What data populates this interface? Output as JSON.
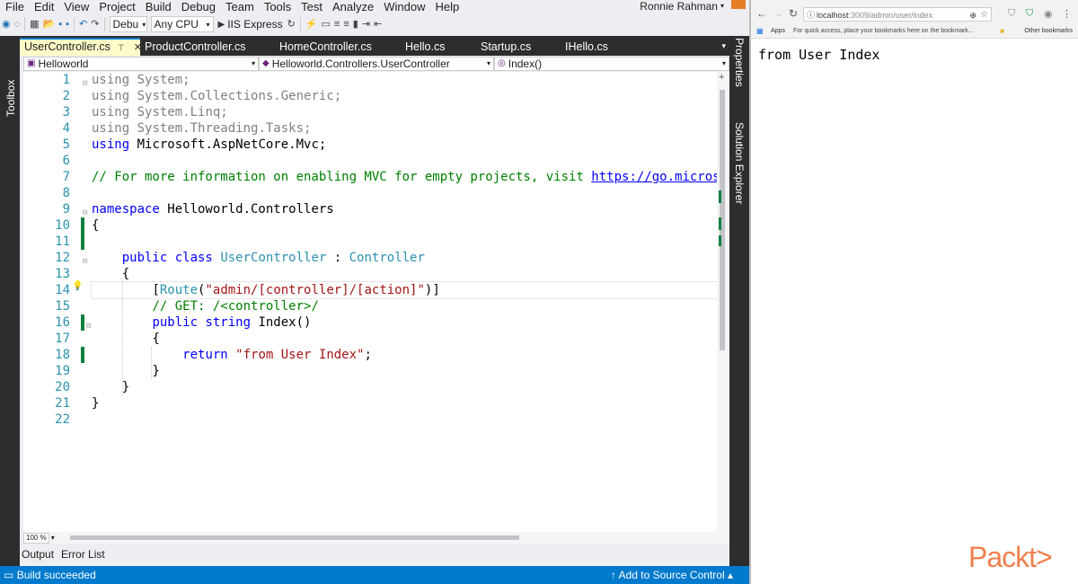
{
  "menu": [
    "File",
    "Edit",
    "View",
    "Project",
    "Build",
    "Debug",
    "Team",
    "Tools",
    "Test",
    "Analyze",
    "Window",
    "Help"
  ],
  "user_name": "Ronnie Rahman",
  "toolbar": {
    "config": "Debu",
    "platform": "Any CPU",
    "run_target": "IIS Express"
  },
  "side_panels": {
    "left": "Toolbox",
    "right_1": "Properties",
    "right_2": "Solution Explorer"
  },
  "tabs": [
    {
      "label": "UserController.cs",
      "active": true
    },
    {
      "label": "ProductController.cs"
    },
    {
      "label": "HomeController.cs"
    },
    {
      "label": "Hello.cs"
    },
    {
      "label": "Startup.cs"
    },
    {
      "label": "IHello.cs"
    }
  ],
  "nav": {
    "project": "Helloworld",
    "class": "Helloworld.Controllers.UserController",
    "member": "Index()"
  },
  "line_numbers": [
    "1",
    "2",
    "3",
    "4",
    "5",
    "6",
    "7",
    "8",
    "9",
    "10",
    "11",
    "12",
    "13",
    "14",
    "15",
    "16",
    "17",
    "18",
    "19",
    "20",
    "21",
    "22"
  ],
  "code": {
    "l1_kw": "using",
    "l1_rest": " System;",
    "l2_kw": "using",
    "l2_rest": " System.Collections.Generic;",
    "l3_kw": "using",
    "l3_rest": " System.Linq;",
    "l4_kw": "using",
    "l4_rest": " System.Threading.Tasks;",
    "l5_kw": "using",
    "l5_rest": " Microsoft.AspNetCore.Mvc;",
    "l7_comment": "// For more information on enabling MVC for empty projects, visit ",
    "l7_link": "https://go.microsoft",
    "l9_kw": "namespace",
    "l9_rest": " Helloworld.Controllers",
    "l10": "{",
    "l12_kw": "public class",
    "l12_type": "UserController",
    "l12_colon": " : ",
    "l12_base": "Controller",
    "l13": "{",
    "l14_open": "[",
    "l14_attr": "Route",
    "l14_paren": "(",
    "l14_str": "\"admin/[controller]/[action]\"",
    "l14_close": ")]",
    "l15": "// GET: /<controller>/",
    "l16_kw": "public string",
    "l16_rest": " Index()",
    "l17": "{",
    "l18_kw": "return",
    "l18_str": "\"from User Index\"",
    "l18_end": ";",
    "l19": "}",
    "l20": "}",
    "l21": "}"
  },
  "zoom": "100 %",
  "bottom_tabs": [
    "Output",
    "Error List"
  ],
  "status": {
    "left": "Build succeeded",
    "right": "Add to Source Control"
  },
  "browser": {
    "host": "localhost",
    "path": ":3009/admin/user/index",
    "bookmarks": {
      "apps": "Apps",
      "hint": "For quick access, place your bookmarks here on the bookmark...",
      "other": "Other bookmarks"
    },
    "page_text": "from User Index"
  },
  "watermark": "Packt>"
}
